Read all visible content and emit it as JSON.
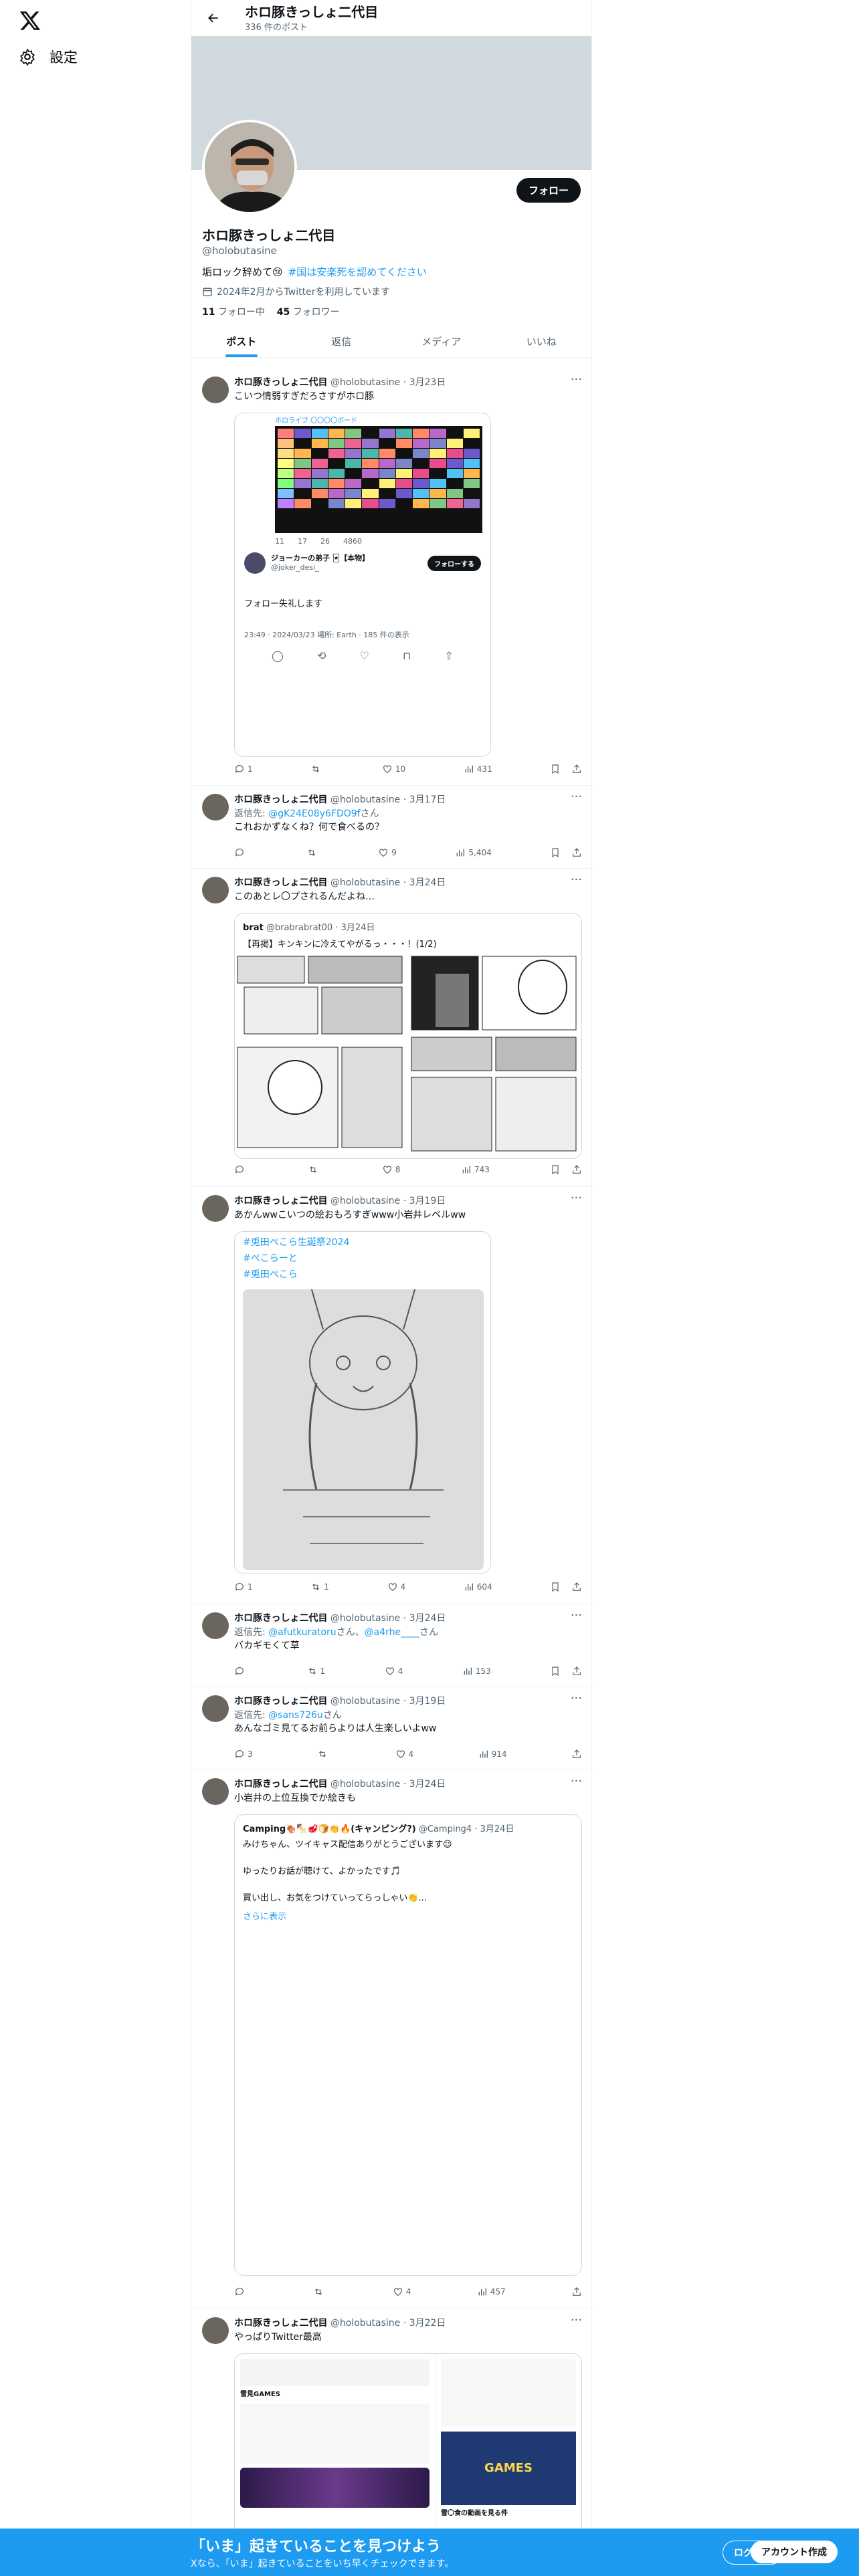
{
  "sidebar": {
    "settings_label": "設定"
  },
  "topbar": {
    "name": "ホロ豚きっしょ二代目",
    "post_count": "336 件のポスト"
  },
  "profile": {
    "name": "ホロ豚きっしょ二代目",
    "handle": "@holobutasine",
    "follow_label": "フォロー",
    "bio": "垢ロック辞めて😢",
    "bio_tag": "#国は安楽死を認めてください",
    "joined": "2024年2月からTwitterを利用しています",
    "following_count": "11",
    "following_label": "フォロー中",
    "followers_count": "45",
    "followers_label": "フォロワー"
  },
  "tabs": [
    "ポスト",
    "返信",
    "メディア",
    "いいね"
  ],
  "tweets": [
    {
      "name": "ホロ豚きっしょ二代目",
      "handle": "@holobutasine",
      "date": "3月23日",
      "text": "こいつ情弱すぎだろさすがホロ豚",
      "embed": {
        "header": "ホロライブ 〇〇〇〇ボード",
        "mini_stats": [
          "11",
          "17",
          "26",
          "4860"
        ],
        "user_name": "ジョーカーの弟子 🃏【本物】",
        "user_handle": "@joker_desi_",
        "follow_label": "フォローする",
        "text": "フォロー失礼します",
        "meta": "23:49 · 2024/03/23 場所: Earth · 185 件の表示"
      },
      "replies": "1",
      "retweets": "",
      "likes": "10",
      "views": "431"
    },
    {
      "name": "ホロ豚きっしょ二代目",
      "handle": "@holobutasine",
      "date": "3月17日",
      "reply_prefix": "返信先: ",
      "reply_to": "@gK24E08y6FDO9f",
      "reply_suffix": "さん",
      "text": "これおかずなくね？何で食べるの？",
      "replies": "",
      "retweets": "",
      "likes": "9",
      "views": "5,404"
    },
    {
      "name": "ホロ豚きっしょ二代目",
      "handle": "@holobutasine",
      "date": "3月24日",
      "text": "このあとレ〇プされるんだよね…",
      "quote": {
        "name": "brat",
        "handle": "@brabrabrat00",
        "date": "3月24日",
        "text": "【再掲】キンキンに冷えてやがるっ・・・！(1/2)"
      },
      "replies": "",
      "retweets": "",
      "likes": "8",
      "views": "743"
    },
    {
      "name": "ホロ豚きっしょ二代目",
      "handle": "@holobutasine",
      "date": "3月19日",
      "text": "あかんwwこいつの絵おもろすぎwww小岩井レベルww",
      "embed_tags": [
        "#兎田ぺこら生誕祭2024",
        "#ぺこらーと",
        "#兎田ぺこら"
      ],
      "replies": "1",
      "retweets": "1",
      "likes": "4",
      "views": "604"
    },
    {
      "name": "ホロ豚きっしょ二代目",
      "handle": "@holobutasine",
      "date": "3月24日",
      "reply_prefix": "返信先: ",
      "reply_to": "@afutkuratoru",
      "reply_suffix": "さん、",
      "reply_to2": "@a4rhe____",
      "reply_suffix2": "さん",
      "text": "バカギモくて草",
      "replies": "",
      "retweets": "1",
      "likes": "4",
      "views": "153"
    },
    {
      "name": "ホロ豚きっしょ二代目",
      "handle": "@holobutasine",
      "date": "3月19日",
      "reply_prefix": "返信先: ",
      "reply_to": "@sans726u",
      "reply_suffix": "さん",
      "text": "あんなゴミ見てるお前らよりは人生楽しいよww",
      "replies": "3",
      "retweets": "",
      "likes": "4",
      "views": "914"
    },
    {
      "name": "ホロ豚きっしょ二代目",
      "handle": "@holobutasine",
      "date": "3月24日",
      "text": "小岩井の上位互換でか絵きも",
      "quote": {
        "name": "Camping🍖🍢🥩🍞👏🔥(キャンピング?)",
        "handle": "@Camping4",
        "date": "3月24日",
        "text": "みけちゃん、ツイキャス配信ありがとうございます😉\n\nゆったりお話が聴けて、よかったです🎵\n\n買い出し、お気をつけていってらっしゃい👏...",
        "more": "さらに表示"
      },
      "replies": "",
      "retweets": "",
      "likes": "4",
      "views": "457"
    },
    {
      "name": "ホロ豚きっしょ二代目",
      "handle": "@holobutasine",
      "date": "3月22日",
      "text": "やっぱりTwitter最高",
      "embed_text": {
        "left_label": "雪見GAMES",
        "right_title": "GAMES",
        "right_caption": "雪〇食の動画を見る件"
      }
    }
  ],
  "bottom_bar": {
    "title": "「いま」起きていることを見つけよう",
    "subtitle": "Xなら、「いま」起きていることをいち早くチェックできます。",
    "login": "ログイン",
    "signup": "アカウント作成"
  },
  "colors": {
    "accent": "#1d9bf0",
    "text": "#0f1419",
    "muted": "#536471",
    "border": "#eff3f4"
  }
}
